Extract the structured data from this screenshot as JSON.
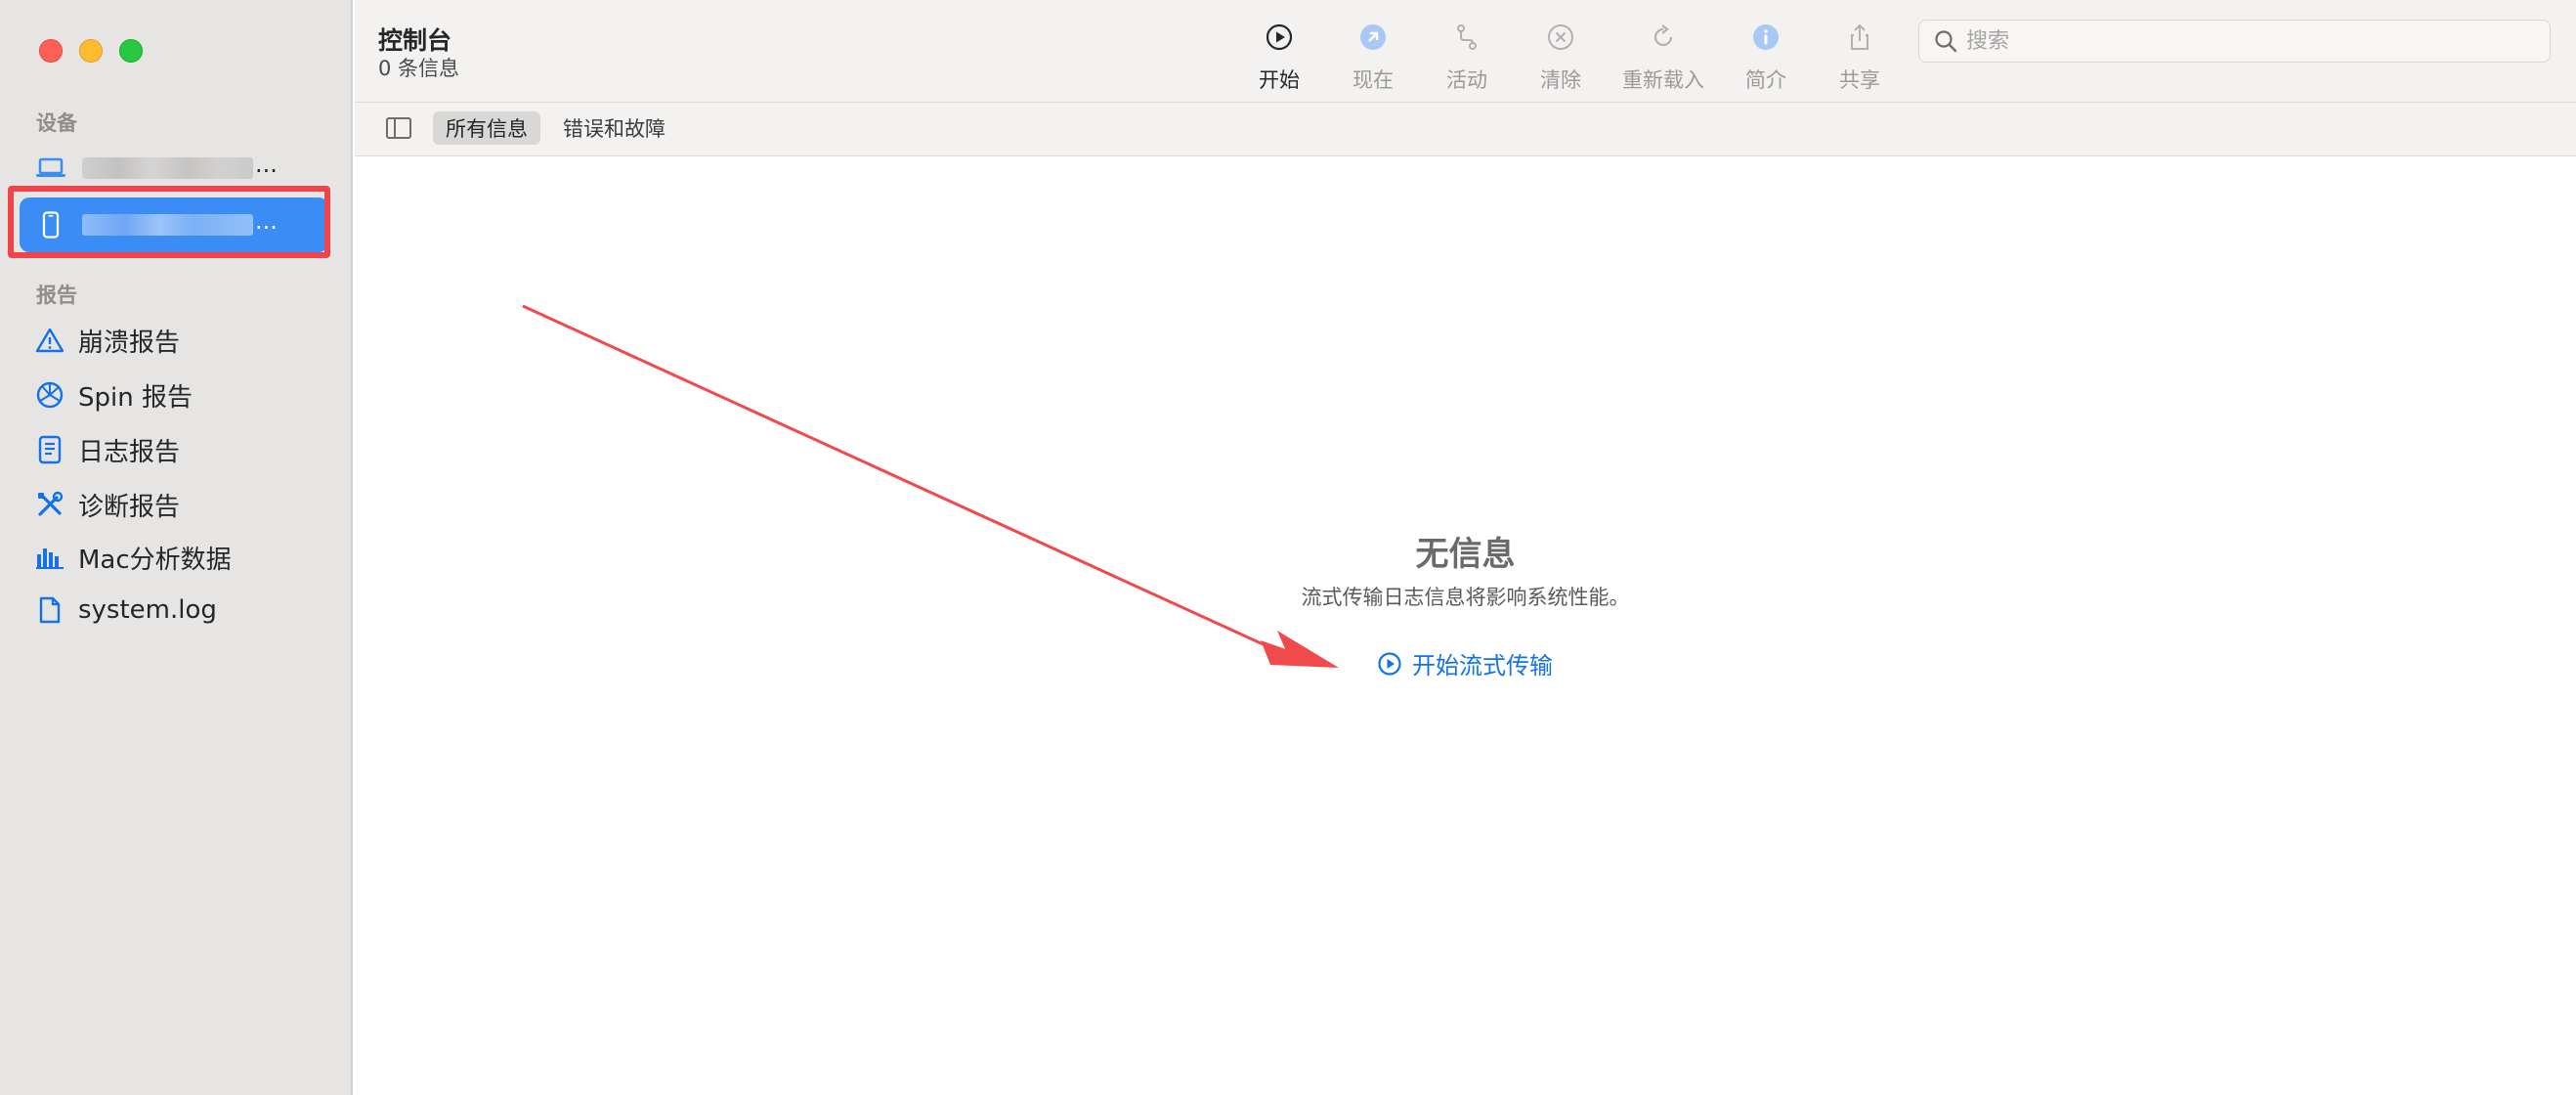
{
  "window": {
    "title": "控制台",
    "message_count": "0 条信息"
  },
  "sidebar": {
    "devices_label": "设备",
    "reports_label": "报告",
    "devices": [
      {
        "type": "mac"
      },
      {
        "type": "iphone"
      }
    ],
    "device_suffix": "...",
    "reports": [
      {
        "label": "崩溃报告",
        "icon": "warning-icon"
      },
      {
        "label": "Spin 报告",
        "icon": "spin-icon"
      },
      {
        "label": "日志报告",
        "icon": "document-icon"
      },
      {
        "label": "诊断报告",
        "icon": "tools-icon"
      },
      {
        "label": "Mac分析数据",
        "icon": "bar-chart-icon"
      },
      {
        "label": "system.log",
        "icon": "file-icon"
      }
    ]
  },
  "toolbar": {
    "start": "开始",
    "now": "现在",
    "activity": "活动",
    "clear": "清除",
    "reload": "重新载入",
    "info": "简介",
    "share": "共享",
    "search_placeholder": "搜索"
  },
  "filters": {
    "all": "所有信息",
    "errors": "错误和故障"
  },
  "main": {
    "empty_title": "无信息",
    "empty_subtitle": "流式传输日志信息将影响系统性能。",
    "start_streaming": "开始流式传输"
  },
  "colors": {
    "accent": "#1472e8",
    "selection": "#3b8cf5",
    "annotation": "#f0434a"
  }
}
